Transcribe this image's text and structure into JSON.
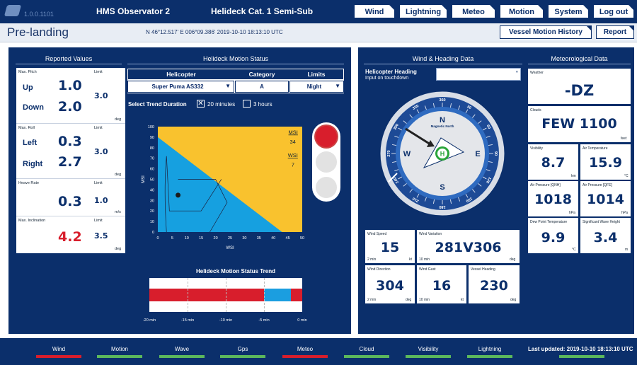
{
  "app": {
    "version": "1.0.0.1101",
    "system_name": "HMS Observator 2",
    "helideck": "Helideck Cat. 1 Semi-Sub"
  },
  "nav": {
    "wind": "Wind",
    "lightning": "Lightning",
    "meteo": "Meteo",
    "motion": "Motion",
    "system": "System",
    "logout": "Log out"
  },
  "page": {
    "title": "Pre-landing",
    "coords": "N 46°12.517'  E 006°09.386'  2019-10-10 18:13:10 UTC",
    "vessel_motion_history": "Vessel Motion History",
    "report": "Report"
  },
  "reported": {
    "title": "Reported Values",
    "pitch": {
      "label": "Max. Pitch",
      "limit_label": "Limit",
      "up_name": "Up",
      "up": "1.0",
      "down_name": "Down",
      "down": "2.0",
      "limit": "3.0",
      "unit": "deg"
    },
    "roll": {
      "label": "Max. Roll",
      "limit_label": "Limit",
      "left_name": "Left",
      "left": "0.3",
      "right_name": "Right",
      "right": "2.7",
      "limit": "3.0",
      "unit": "deg"
    },
    "heave": {
      "label": "Heave Rate",
      "limit_label": "Limit",
      "value": "0.3",
      "limit": "1.0",
      "unit": "m/s"
    },
    "inclination": {
      "label": "Max. Inclination",
      "limit_label": "Limit",
      "value": "4.2",
      "limit": "3.5",
      "unit": "deg",
      "alert_color": "#d81e2c"
    }
  },
  "motion_status": {
    "title": "Helideck Motion Status",
    "col_helicopter": "Helicopter",
    "col_category": "Category",
    "col_limits": "Limits",
    "helicopter": "Super Puma AS332",
    "category": "A",
    "limits": "Night",
    "trend_label": "Select Trend Duration",
    "opt_20": "20 minutes",
    "opt_3h": "3 hours",
    "opt_20_checked": true,
    "trend_title": "Helideck Motion Status Trend",
    "trend_ticks": [
      "-20 min",
      "-15 min",
      "-10 min",
      "-5 min",
      "0 min"
    ]
  },
  "chart_data": {
    "type": "area",
    "xlabel": "WSI",
    "ylabel": "MSI",
    "xlim": [
      0,
      50
    ],
    "ylim": [
      0,
      100
    ],
    "x_ticks": [
      0,
      5,
      10,
      15,
      20,
      25,
      30,
      35,
      40,
      45,
      50
    ],
    "y_ticks": [
      0,
      10,
      20,
      30,
      40,
      50,
      60,
      70,
      80,
      90,
      100
    ],
    "safe_boundary": [
      [
        0,
        90
      ],
      [
        43,
        0
      ]
    ],
    "current_point": [
      7,
      35
    ],
    "msi_label": "MSI",
    "msi_value": "34",
    "wsi_label": "WSI",
    "wsi_value": "7",
    "colors": {
      "safe": "#16a0e0",
      "unsafe": "#f9c22e"
    }
  },
  "trend_bars": {
    "segments": [
      {
        "from": -20,
        "to": -5,
        "color": "#d81e2c"
      },
      {
        "from": -5,
        "to": -1.5,
        "color": "#1b9ee0"
      },
      {
        "from": -1.5,
        "to": 0,
        "color": "#d81e2c"
      }
    ]
  },
  "traffic_light": {
    "active": "red",
    "colors": {
      "red": "#d81e2c",
      "off": "#e2e2e2"
    }
  },
  "wind_heading": {
    "title": "Wind & Heading Data",
    "heading_label": "Helicopter Heading",
    "heading_sub": "Input on touchdown",
    "compass": {
      "n": "N",
      "e": "E",
      "s": "S",
      "w": "W",
      "magnetic_north": "Magnetic North",
      "degrees": [
        "360",
        "30",
        "60",
        "90",
        "120",
        "150",
        "180",
        "210",
        "240",
        "270",
        "300",
        "330"
      ]
    },
    "wind_speed": {
      "label": "Wind Speed",
      "value": "15",
      "period": "2 min",
      "unit": "kt"
    },
    "wind_variation": {
      "label": "Wind Variation",
      "value": "281V306",
      "period": "10 min",
      "unit": "deg"
    },
    "wind_direction": {
      "label": "Wind Direction",
      "value": "304",
      "period": "2 min",
      "unit": "deg"
    },
    "wind_gust": {
      "label": "Wind Gust",
      "value": "16",
      "period": "10 min",
      "unit": "kt"
    },
    "vessel_heading": {
      "label": "Vessel Heading",
      "value": "230",
      "unit": "deg"
    }
  },
  "meteo": {
    "title": "Meteorological Data",
    "weather": {
      "label": "Weather",
      "value": "-DZ"
    },
    "clouds": {
      "label": "Clouds",
      "value": "FEW 1100",
      "unit": "feet"
    },
    "visibility": {
      "label": "Visibility",
      "value": "8.7",
      "unit": "km"
    },
    "air_temp": {
      "label": "Air Temperature",
      "value": "15.9",
      "unit": "°C"
    },
    "qnh": {
      "label": "Air Pressure [QNH]",
      "value": "1018",
      "unit": "hPa"
    },
    "qfe": {
      "label": "Air Pressure [QFE]",
      "value": "1014",
      "unit": "hPa"
    },
    "dew_point": {
      "label": "Dew Point Temperature",
      "value": "9.9",
      "unit": "°C"
    },
    "wave_height": {
      "label": "Significant Wave Height",
      "value": "3.4",
      "unit": "m"
    }
  },
  "footer": {
    "items": [
      {
        "label": "Wind",
        "color": "#d81e2c"
      },
      {
        "label": "Motion",
        "color": "#5cb85c"
      },
      {
        "label": "Wave",
        "color": "#5cb85c"
      },
      {
        "label": "Gps",
        "color": "#5cb85c"
      },
      {
        "label": "Meteo",
        "color": "#d81e2c"
      },
      {
        "label": "Cloud",
        "color": "#5cb85c"
      },
      {
        "label": "Visibility",
        "color": "#5cb85c"
      },
      {
        "label": "Lightning",
        "color": "#5cb85c"
      }
    ],
    "last_updated": "Last updated: 2019-10-10 18:13:10 UTC"
  }
}
